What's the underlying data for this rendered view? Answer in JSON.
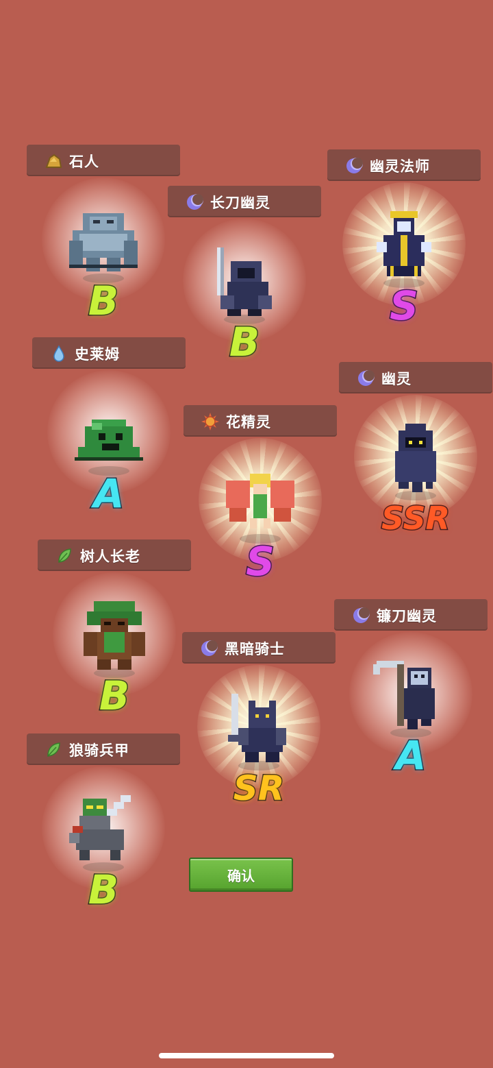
{
  "monsters": [
    {
      "name": "石人",
      "element": "earth-icon",
      "rank": "B"
    },
    {
      "name": "长刀幽灵",
      "element": "moon-icon",
      "rank": "B"
    },
    {
      "name": "幽灵法师",
      "element": "moon-icon",
      "rank": "S"
    },
    {
      "name": "史莱姆",
      "element": "water-icon",
      "rank": "A"
    },
    {
      "name": "幽灵",
      "element": "moon-icon",
      "rank": "SSR"
    },
    {
      "name": "花精灵",
      "element": "sun-icon",
      "rank": "S"
    },
    {
      "name": "树人长老",
      "element": "leaf-icon",
      "rank": "B"
    },
    {
      "name": "镰刀幽灵",
      "element": "moon-icon",
      "rank": "A"
    },
    {
      "name": "黑暗骑士",
      "element": "moon-icon",
      "rank": "SR"
    },
    {
      "name": "狼骑兵甲",
      "element": "leaf-icon",
      "rank": "B"
    }
  ],
  "confirm_label": "确认",
  "colors": {
    "background": "#b95d50",
    "rank_B": "#c8f23a",
    "rank_A": "#46e6f2",
    "rank_S": "#e04ae8",
    "rank_SR": "#ffc21e",
    "rank_SSR": "#ff5a26",
    "confirm_button": "#62ad38"
  }
}
